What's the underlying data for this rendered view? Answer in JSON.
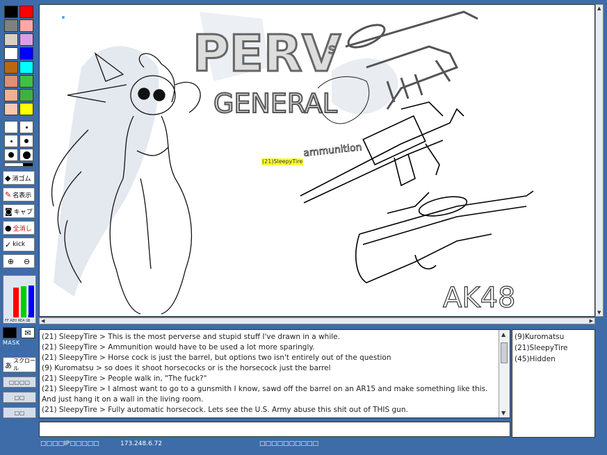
{
  "palette": {
    "colors": [
      "#000000",
      "#ff0000",
      "#808080",
      "#ffa8a8",
      "#d8d0c0",
      "#d8a0e0",
      "#ffffff",
      "#0000ff",
      "#b86810",
      "#00ffff",
      "#e09070",
      "#40c040",
      "#f0b090",
      "#40b040",
      "#f8c8b0",
      "#ffff00"
    ]
  },
  "tools": {
    "eraser_label": "消ゴム",
    "names_label": "名表示",
    "capture_label": "キャプ",
    "clear_label": "全消し",
    "kick_label": "kick"
  },
  "sliders": {
    "labels": [
      "FF",
      "E0",
      "EA",
      "EC"
    ],
    "channels": [
      "A",
      "R",
      "G",
      "B"
    ],
    "colors": [
      "#7f7f7f",
      "#ff0000",
      "#00d000",
      "#0000ff"
    ],
    "levels": [
      0.0,
      0.85,
      0.9,
      0.92
    ]
  },
  "mask": {
    "label": "MASK"
  },
  "scroll": {
    "label": "スクロール"
  },
  "canvas": {
    "user_tag": "(21)SleepyTire",
    "art_text": [
      "PERV",
      "s",
      "GENERAL",
      "ammunition",
      "AK48"
    ]
  },
  "chat": {
    "lines": [
      "(21) SleepyTire > This is the most perverse and stupid stuff I've drawn in a while.",
      "(21) SleepyTire > Ammunition would have to be used a lot more sparingly.",
      "(21) SleepyTire > Horse cock is just the barrel, but options two isn't entirely out of the question",
      "(9) Kuromatsu > so does it shoot horsecocks or is the horsecock just the barrel",
      "(21) SleepyTire > People walk in, \"The fuck?\"",
      "(21) SleepyTire > I almost want to go to a gunsmith I know, sawd off the barrel on an AR15 and make something like this. And just hang it on a wall in the living room.",
      "(21) SleepyTire > Fully automatic horsecock. Lets see the U.S. Army abuse this shit out of THIS gun."
    ]
  },
  "users": [
    "(9)Kuromatsu",
    "(21)SleepyTire",
    "(45)Hidden"
  ],
  "input": {
    "value": ""
  },
  "status": {
    "left": "□□□□IP□□□□□",
    "ip": "173.248.6.72",
    "right": "□□□□□□□□□□"
  }
}
